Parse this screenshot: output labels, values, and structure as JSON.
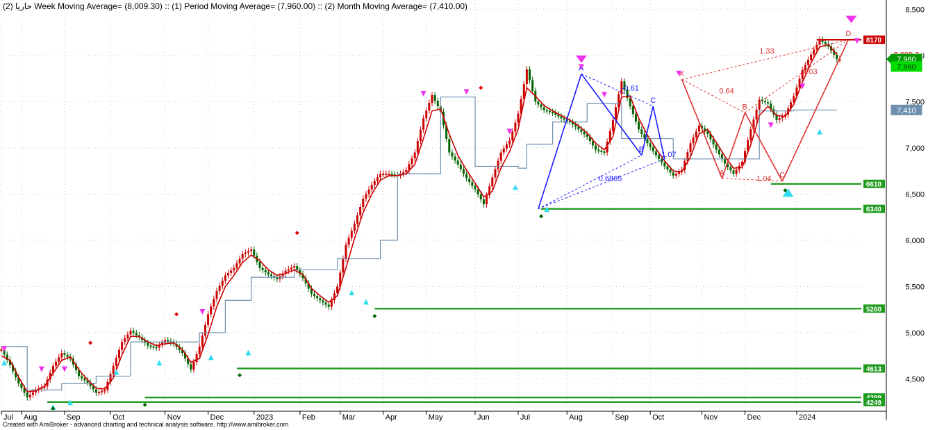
{
  "header": {
    "title": "حاريا (2) Week Moving Average= (8,009.30) :: (1) Period Moving Average= (7,960.00) :: (2) Month Moving Average= (7,410.00)"
  },
  "footer": {
    "text": "Created with AmiBroker - advanced charting and technical analysis software. http://www.amibroker.com"
  },
  "colors": {
    "candle": "#006400",
    "up": "#cc0000",
    "wma": "#cc0000",
    "month": "#6f8faf",
    "support": "#1f9b1f",
    "harmonic_blue": "#1a1aff",
    "harmonic_red": "#e03030",
    "arrow_down": "#ee33ee",
    "arrow_up": "#33ddee"
  },
  "chart_data": {
    "type": "line",
    "y_axis": {
      "ylim": [
        4150,
        8600
      ],
      "ticks": [
        "8,500",
        "8,000",
        "7,500",
        "7,000",
        "6,500",
        "6,000",
        "5,500",
        "5,000",
        "4,500"
      ],
      "tick_values": [
        8500,
        8000,
        7500,
        7000,
        6500,
        6000,
        5500,
        5000,
        4500
      ]
    },
    "x_axis": {
      "labels": [
        "Jul",
        "Aug",
        "Sep",
        "Oct",
        "Nov",
        "Dec",
        "2023",
        "Feb",
        "Mar",
        "Apr",
        "May",
        "Jun",
        "Jul",
        "Aug",
        "Sep",
        "Oct",
        "Nov",
        "Dec",
        "2024"
      ],
      "positions": [
        0,
        7,
        22,
        38,
        57,
        72,
        88,
        104,
        118,
        133,
        148,
        165,
        180,
        197,
        213,
        226,
        244,
        259,
        277
      ]
    },
    "series": [
      {
        "name": "Period Moving Average",
        "x": [
          0,
          3,
          6,
          9,
          12,
          15,
          18,
          21,
          24,
          27,
          30,
          33,
          36,
          39,
          42,
          45,
          48,
          51,
          54,
          57,
          60,
          63,
          66,
          69,
          72,
          75,
          78,
          81,
          84,
          87,
          90,
          93,
          96,
          99,
          102,
          105,
          108,
          111,
          114,
          117,
          120,
          123,
          126,
          129,
          132,
          135,
          138,
          141,
          144,
          147,
          150,
          153,
          156,
          159,
          162,
          165,
          168,
          171,
          174,
          177,
          180,
          183,
          186,
          189,
          192,
          195,
          198,
          201,
          204,
          207,
          210,
          213,
          216,
          219,
          222,
          225,
          228,
          231,
          234,
          237,
          240,
          243,
          246,
          249,
          252,
          255,
          258,
          261,
          264,
          267,
          270,
          273,
          276,
          279,
          282,
          285,
          288,
          291
        ],
        "values": [
          4820,
          4650,
          4450,
          4300,
          4380,
          4420,
          4640,
          4780,
          4720,
          4530,
          4460,
          4350,
          4380,
          4640,
          4900,
          5020,
          4950,
          4860,
          4840,
          4920,
          4880,
          4780,
          4600,
          4850,
          5200,
          5450,
          5620,
          5700,
          5850,
          5900,
          5700,
          5630,
          5580,
          5670,
          5720,
          5590,
          5420,
          5350,
          5280,
          5500,
          5950,
          6180,
          6450,
          6600,
          6720,
          6720,
          6700,
          6760,
          6950,
          7320,
          7570,
          7390,
          6950,
          6820,
          6670,
          6550,
          6390,
          6680,
          6950,
          7080,
          7370,
          7850,
          7500,
          7410,
          7380,
          7320,
          7280,
          7200,
          7120,
          6980,
          6950,
          7300,
          7720,
          7450,
          7200,
          7050,
          6920,
          6800,
          6700,
          6760,
          7050,
          7240,
          7150,
          6980,
          6830,
          6720,
          6850,
          7200,
          7520,
          7480,
          7300,
          7360,
          7560,
          7840,
          8010,
          8170,
          8100,
          7960
        ]
      },
      {
        "name": "Week Moving Average",
        "x": [
          0,
          3,
          6,
          9,
          12,
          15,
          18,
          21,
          24,
          27,
          30,
          33,
          36,
          39,
          42,
          45,
          48,
          51,
          54,
          57,
          60,
          63,
          66,
          69,
          72,
          75,
          78,
          81,
          84,
          87,
          90,
          93,
          96,
          99,
          102,
          105,
          108,
          111,
          114,
          117,
          120,
          123,
          126,
          129,
          132,
          135,
          138,
          141,
          144,
          147,
          150,
          153,
          156,
          159,
          162,
          165,
          168,
          171,
          174,
          177,
          180,
          183,
          186,
          189,
          192,
          195,
          198,
          201,
          204,
          207,
          210,
          213,
          216,
          219,
          222,
          225,
          228,
          231,
          234,
          237,
          240,
          243,
          246,
          249,
          252,
          255,
          258,
          261,
          264,
          267,
          270,
          273,
          276,
          279,
          282,
          285,
          288,
          291
        ],
        "values": [
          4750,
          4700,
          4520,
          4360,
          4370,
          4420,
          4560,
          4700,
          4740,
          4600,
          4490,
          4400,
          4390,
          4510,
          4760,
          4960,
          4960,
          4900,
          4860,
          4880,
          4890,
          4820,
          4680,
          4720,
          4980,
          5280,
          5500,
          5620,
          5760,
          5840,
          5780,
          5680,
          5620,
          5640,
          5680,
          5630,
          5480,
          5400,
          5330,
          5400,
          5700,
          6020,
          6300,
          6500,
          6650,
          6700,
          6700,
          6720,
          6820,
          7100,
          7400,
          7420,
          7150,
          6920,
          6760,
          6620,
          6470,
          6530,
          6780,
          6960,
          7200,
          7650,
          7560,
          7460,
          7400,
          7350,
          7300,
          7240,
          7160,
          7050,
          6980,
          7120,
          7550,
          7560,
          7320,
          7140,
          6990,
          6860,
          6750,
          6740,
          6900,
          7150,
          7200,
          7060,
          6910,
          6780,
          6790,
          7030,
          7350,
          7450,
          7350,
          7340,
          7470,
          7710,
          7920,
          8090,
          8120,
          8009.3
        ]
      },
      {
        "name": "Month Moving Average",
        "x": [
          0,
          3,
          6,
          9,
          12,
          15,
          18,
          21,
          24,
          27,
          30,
          33,
          36,
          39,
          42,
          45,
          48,
          51,
          54,
          57,
          60,
          63,
          66,
          69,
          72,
          75,
          78,
          81,
          84,
          87,
          90,
          93,
          96,
          99,
          102,
          105,
          108,
          111,
          114,
          117,
          120,
          123,
          126,
          129,
          132,
          135,
          138,
          141,
          144,
          147,
          150,
          153,
          156,
          159,
          162,
          165,
          168,
          171,
          174,
          177,
          180,
          183,
          186,
          189,
          192,
          195,
          198,
          201,
          204,
          207,
          210,
          213,
          216,
          219,
          222,
          225,
          228,
          231,
          234,
          237,
          240,
          243,
          246,
          249,
          252,
          255,
          258,
          261,
          264,
          267,
          270,
          273,
          276,
          279,
          282,
          285,
          288,
          291
        ],
        "values": [
          4850,
          4850,
          4850,
          4380,
          4380,
          4380,
          4380,
          4450,
          4450,
          4450,
          4450,
          4530,
          4530,
          4530,
          4530,
          4900,
          4900,
          4900,
          4900,
          4900,
          4900,
          4900,
          4900,
          5000,
          5000,
          5000,
          5350,
          5350,
          5350,
          5600,
          5600,
          5600,
          5600,
          5600,
          5680,
          5680,
          5680,
          5680,
          5680,
          5800,
          5800,
          5800,
          5800,
          5800,
          6000,
          6000,
          6720,
          6720,
          6720,
          6720,
          6720,
          7550,
          7550,
          7550,
          7550,
          6800,
          6800,
          6800,
          6800,
          6800,
          6780,
          7040,
          7040,
          7040,
          7280,
          7280,
          7280,
          7280,
          7480,
          7480,
          7480,
          7480,
          7100,
          7100,
          7100,
          7100,
          7100,
          7100,
          6880,
          6880,
          6880,
          6880,
          6880,
          6880,
          6880,
          6880,
          6880,
          6880,
          7400,
          7400,
          7400,
          7400,
          7410,
          7410,
          7410,
          7410,
          7410,
          7410
        ]
      }
    ],
    "price_labels": [
      {
        "text": "8,009.3",
        "value": 8009.3,
        "bg": "#ffffff",
        "fg": "#cc0000"
      },
      {
        "text": "7,960",
        "value": 7960,
        "bg": "#009900",
        "fg": "#ffffff"
      },
      {
        "text": "7,960",
        "value": 7880,
        "bg": "#00dd00",
        "fg": "#003300"
      },
      {
        "text": "7,410",
        "value": 7410,
        "bg": "#6f8faf",
        "fg": "#ffffff"
      }
    ],
    "support_levels": [
      {
        "text": "8170",
        "value": 8170,
        "x_start": 284,
        "bg": "#cc0000"
      },
      {
        "text": "6610",
        "value": 6610,
        "x_start": 268,
        "bg": "#1f9b1f"
      },
      {
        "text": "6340",
        "value": 6340,
        "x_start": 188,
        "bg": "#1f9b1f"
      },
      {
        "text": "5260",
        "value": 5260,
        "x_start": 130,
        "bg": "#1f9b1f"
      },
      {
        "text": "4613",
        "value": 4613,
        "x_start": 82,
        "bg": "#1f9b1f"
      },
      {
        "text": "4299",
        "value": 4299,
        "x_start": 50,
        "bg": "#1f9b1f"
      },
      {
        "text": "4249",
        "value": 4249,
        "x_start": 16,
        "bg": "#1f9b1f"
      }
    ],
    "harmonic_blue": {
      "points": [
        {
          "label": "",
          "x": 187,
          "y": 6340
        },
        {
          "label": "A",
          "x": 202,
          "y": 7800
        },
        {
          "label": "B",
          "x": 223,
          "y": 6920
        },
        {
          "label": "C",
          "x": 227,
          "y": 7450
        },
        {
          "label": "",
          "x": 231,
          "y": 6880
        }
      ],
      "ratios": [
        {
          "text": "-0.61",
          "x": 216,
          "y": 7620
        },
        {
          "text": "-1.07",
          "x": 229,
          "y": 6900
        },
        {
          "text": "0.6865",
          "x": 208,
          "y": 6640
        }
      ]
    },
    "harmonic_red": {
      "points": [
        {
          "label": "X",
          "x": 237,
          "y": 7740
        },
        {
          "label": "A",
          "x": 251,
          "y": 6670
        },
        {
          "label": "B",
          "x": 259,
          "y": 7380
        },
        {
          "label": "C",
          "x": 272,
          "y": 6640
        },
        {
          "label": "D",
          "x": 295,
          "y": 8170
        }
      ],
      "ratios": [
        {
          "text": "1.33",
          "x": 264,
          "y": 8020
        },
        {
          "text": "0.64",
          "x": 250,
          "y": 7590
        },
        {
          "text": "2.03",
          "x": 279,
          "y": 7800
        },
        {
          "text": "1.04",
          "x": 263,
          "y": 6640
        }
      ]
    }
  }
}
